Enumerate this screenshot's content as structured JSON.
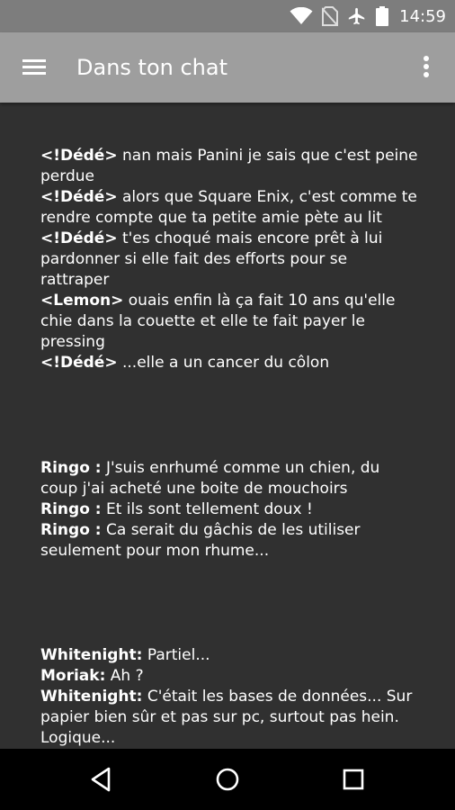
{
  "status_bar": {
    "time": "14:59",
    "icons": [
      "wifi-icon",
      "no-sim-icon",
      "airplane-mode-icon",
      "battery-icon"
    ]
  },
  "app_bar": {
    "title": "Dans ton chat",
    "icons": [
      "hamburger-menu-icon",
      "more-vertical-icon"
    ]
  },
  "quotes": [
    {
      "lines": [
        {
          "speaker": "<!Dédé>",
          "text": " nan mais Panini je sais que c'est peine perdue"
        },
        {
          "speaker": "<!Dédé>",
          "text": " alors que Square Enix, c'est comme te rendre compte que ta petite amie pète au lit"
        },
        {
          "speaker": "<!Dédé>",
          "text": " t'es choqué mais encore prêt à lui pardonner si elle fait des efforts pour se rattraper"
        },
        {
          "speaker": "<Lemon>",
          "text": " ouais enfin là ça fait 10 ans qu'elle chie dans la couette et elle te fait payer le pressing"
        },
        {
          "speaker": "<!Dédé>",
          "text": " ...elle a un cancer du côlon"
        }
      ]
    },
    {
      "lines": [
        {
          "speaker": "Ringo :",
          "text": " J'suis enrhumé comme un chien, du coup j'ai acheté une boite de mouchoirs"
        },
        {
          "speaker": "Ringo :",
          "text": " Et ils sont tellement doux !"
        },
        {
          "speaker": "Ringo :",
          "text": " Ca serait du gâchis de les utiliser seulement pour mon rhume..."
        }
      ]
    },
    {
      "lines": [
        {
          "speaker": "Whitenight:",
          "text": " Partiel..."
        },
        {
          "speaker": "Moriak:",
          "text": " Ah ?"
        },
        {
          "speaker": "Whitenight:",
          "text": " C'était les bases de données... Sur papier bien sûr et pas sur pc, surtout pas hein. Logique..."
        }
      ]
    }
  ],
  "nav_bar": {
    "icons": [
      "back-icon",
      "home-icon",
      "recent-apps-icon"
    ]
  },
  "colors": {
    "status_bar": "#7d7d7d",
    "app_bar": "#9e9e9e",
    "background": "#303030",
    "nav_bar": "#000000",
    "text": "#ffffff"
  }
}
